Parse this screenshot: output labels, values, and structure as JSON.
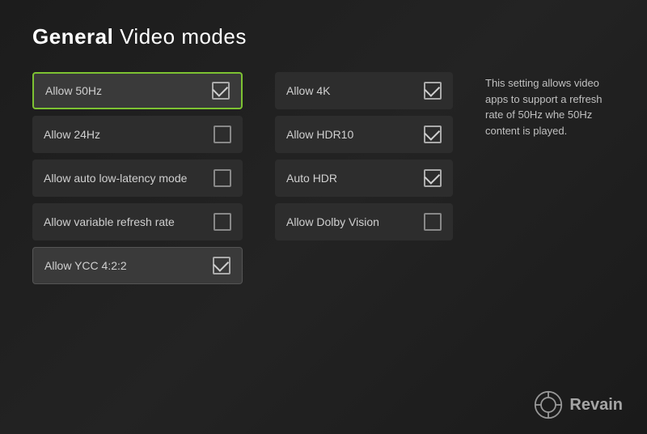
{
  "header": {
    "category": "General",
    "title": "Video modes"
  },
  "description": {
    "text": "This setting allows video apps to support a refresh rate of 50Hz whe 50Hz content is played."
  },
  "left_settings": [
    {
      "id": "allow-50hz",
      "label": "Allow 50Hz",
      "checked": true,
      "active": true
    },
    {
      "id": "allow-24hz",
      "label": "Allow 24Hz",
      "checked": false,
      "active": false
    },
    {
      "id": "allow-auto-low-latency",
      "label": "Allow auto low-latency mode",
      "checked": false,
      "active": false
    },
    {
      "id": "allow-variable-refresh",
      "label": "Allow variable refresh rate",
      "checked": false,
      "active": false
    },
    {
      "id": "allow-ycc",
      "label": "Allow YCC 4:2:2",
      "checked": true,
      "active": false,
      "highlighted": true
    }
  ],
  "right_settings": [
    {
      "id": "allow-4k",
      "label": "Allow 4K",
      "checked": true,
      "active": false
    },
    {
      "id": "allow-hdr10",
      "label": "Allow HDR10",
      "checked": true,
      "active": false
    },
    {
      "id": "auto-hdr",
      "label": "Auto HDR",
      "checked": true,
      "active": false
    },
    {
      "id": "allow-dolby-vision",
      "label": "Allow Dolby Vision",
      "checked": false,
      "active": false
    }
  ],
  "watermark": {
    "text": "Revain"
  }
}
